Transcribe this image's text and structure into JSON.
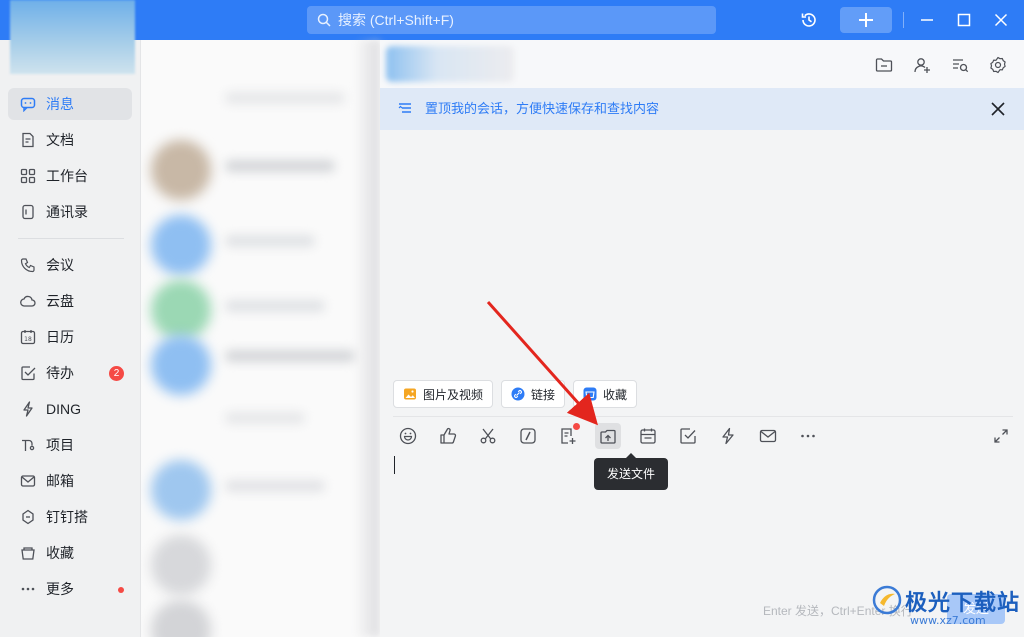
{
  "titlebar": {
    "search_placeholder": "搜索 (Ctrl+Shift+F)",
    "add_label": "+",
    "accent_color": "#2e7cf6"
  },
  "sidebar": {
    "items": [
      {
        "label": "消息",
        "icon": "chat-icon",
        "active": true
      },
      {
        "label": "文档",
        "icon": "document-icon"
      },
      {
        "label": "工作台",
        "icon": "grid-icon"
      },
      {
        "label": "通讯录",
        "icon": "contacts-icon"
      },
      {
        "label": "会议",
        "icon": "phone-icon"
      },
      {
        "label": "云盘",
        "icon": "cloud-icon"
      },
      {
        "label": "日历",
        "icon": "calendar-icon"
      },
      {
        "label": "待办",
        "icon": "check-icon",
        "badge": "2"
      },
      {
        "label": "DING",
        "icon": "lightning-icon"
      },
      {
        "label": "项目",
        "icon": "project-icon"
      },
      {
        "label": "邮箱",
        "icon": "mail-icon"
      },
      {
        "label": "钉钉搭",
        "icon": "build-icon"
      },
      {
        "label": "收藏",
        "icon": "favorite-icon"
      },
      {
        "label": "更多",
        "icon": "more-icon",
        "dot": true
      }
    ]
  },
  "chat": {
    "pin_banner": "置顶我的会话，方便快速保存和查找内容",
    "quick_actions": [
      {
        "label": "图片及视频",
        "icon": "image-icon"
      },
      {
        "label": "链接",
        "icon": "link-icon"
      },
      {
        "label": "收藏",
        "icon": "favorite-box-icon"
      }
    ],
    "toolbar": [
      "emoji-icon",
      "thumbs-up-icon",
      "scissors-icon",
      "slash-command-icon",
      "note-add-icon",
      "upload-file-icon",
      "schedule-icon",
      "task-check-icon",
      "ding-lightning-icon",
      "mail-icon",
      "more-dots-icon"
    ],
    "tooltip": "发送文件",
    "send_hint": "Enter 发送，Ctrl+Enter 换行",
    "send_label": "发送"
  },
  "watermark": {
    "name": "极光下载站",
    "url": "www.xz7.com"
  }
}
